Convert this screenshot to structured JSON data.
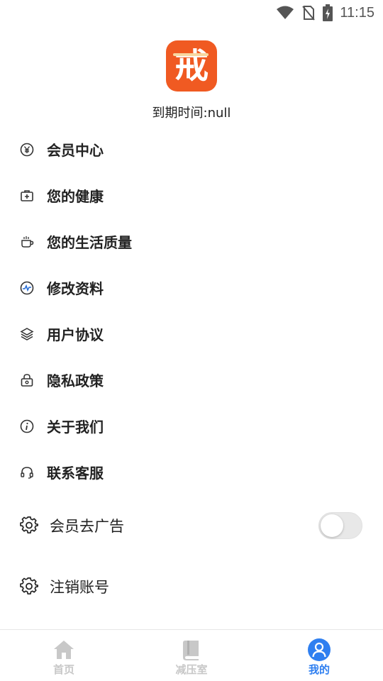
{
  "status_bar": {
    "time": "11:15"
  },
  "header": {
    "logo_char": "戒",
    "expire_text": "到期时间:null"
  },
  "menu": {
    "items": [
      {
        "label": "会员中心",
        "icon": "yen-circle-icon"
      },
      {
        "label": "您的健康",
        "icon": "medical-kit-icon"
      },
      {
        "label": "您的生活质量",
        "icon": "coffee-cup-icon"
      },
      {
        "label": "修改资料",
        "icon": "pulse-circle-icon"
      },
      {
        "label": "用户协议",
        "icon": "layers-icon"
      },
      {
        "label": "隐私政策",
        "icon": "lock-icon"
      },
      {
        "label": "关于我们",
        "icon": "info-circle-icon"
      },
      {
        "label": "联系客服",
        "icon": "headset-icon"
      }
    ]
  },
  "settings": {
    "remove_ads_label": "会员去广告",
    "remove_ads_enabled": false,
    "cancel_account_label": "注销账号"
  },
  "bottom_nav": {
    "items": [
      {
        "label": "首页",
        "icon": "home-icon",
        "active": false
      },
      {
        "label": "减压室",
        "icon": "book-icon",
        "active": false
      },
      {
        "label": "我的",
        "icon": "user-icon",
        "active": true
      }
    ],
    "active_color": "#2f7ff0",
    "inactive_color": "#c8c8c8"
  },
  "colors": {
    "logo_bg": "#f05a22"
  }
}
